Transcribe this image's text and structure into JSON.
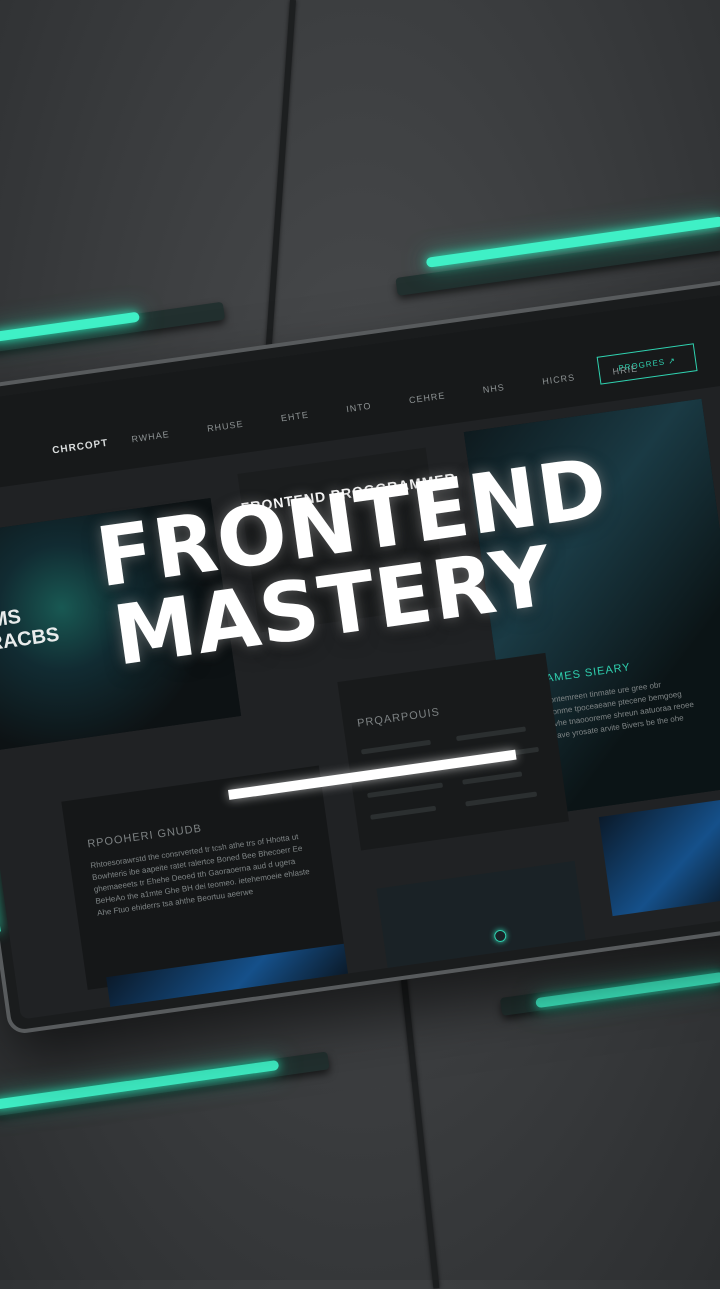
{
  "nav": {
    "brand": "CHRCOPT",
    "items": [
      "RWHAE",
      "RHUSE",
      "EHTE",
      "INTO",
      "CEHRE",
      "NHS",
      "HICRS",
      "HRIE"
    ],
    "cta": "PROGRES ↗"
  },
  "panels": {
    "left_label": "IMS\nRACBS",
    "left_lower_heading": "RPOOHERI GNUDB",
    "left_lower_text": "Rhtoesorawrstd the consrverted tr tcsh athe trs of Hhotta ut Bowhteris ibe aapeite ratet ralertce Boned Bee Bhecoerr Ee ghemaeeets tr Ehehe Deoed tth Gaoraoerna aud d ugera BeHeAo the a1mte Ghe BH dei teomeo. ietehemoeie ehlaste Ahe Ftuo ehiderrs tsa ahthe Beortuu aeerwe",
    "middle_heading": "PRQARPOUIS",
    "right_heading": "FAMES SIEARY",
    "right_text": "Frontemreen tinmate ure gree obr aeonme tpoceaeane ptecene bemgoeg aevhe tnaoooreme shreun aatuoraa reoee Reave yrosate arvite Bivers be the ohe"
  },
  "hero": {
    "eyebrow": "FRONTEND PROGGRAMMER",
    "line1": "FRONTEND",
    "line2": "MASTERY"
  }
}
